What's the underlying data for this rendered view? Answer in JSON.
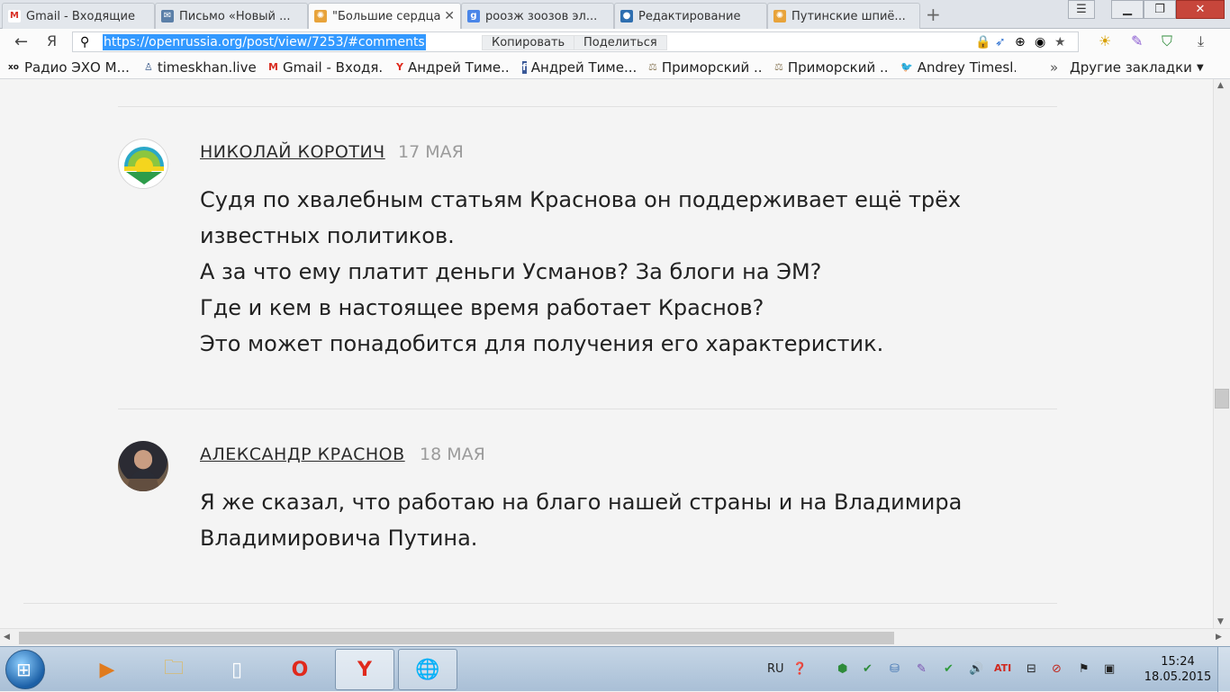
{
  "tabs": [
    {
      "label": "Gmail - Входящие",
      "icon": "gmail-icon",
      "active": false
    },
    {
      "label": "Письмо «Новый ...",
      "icon": "mail-icon",
      "active": false
    },
    {
      "label": "\"Большие сердца",
      "icon": "openrussia-icon",
      "active": true
    },
    {
      "label": "роозж зоозов эл...",
      "icon": "google-icon",
      "active": false
    },
    {
      "label": "Редактирование",
      "icon": "edit-icon",
      "active": false
    },
    {
      "label": "Путинские шпиё...",
      "icon": "openrussia-icon",
      "active": false
    }
  ],
  "toolbar": {
    "back_label": "←",
    "yandex_label": "Я",
    "url": "https://openrussia.org/post/view/7253/#comments",
    "copy_label": "Копировать",
    "share_label": "Поделиться"
  },
  "bookmarks": [
    {
      "label": "Радио ЭХО М...",
      "icon": "echo-icon"
    },
    {
      "label": "timeskhan.live...",
      "icon": "livejournal-icon"
    },
    {
      "label": "Gmail - Входя...",
      "icon": "gmail-icon"
    },
    {
      "label": "Андрей Тиме...",
      "icon": "yandex-icon"
    },
    {
      "label": "Андрей Тиме...",
      "icon": "facebook-icon"
    },
    {
      "label": "Приморский ...",
      "icon": "scales-icon"
    },
    {
      "label": "Приморский ...",
      "icon": "scales-icon"
    },
    {
      "label": "Andrey Timesl...",
      "icon": "twitter-icon"
    }
  ],
  "other_bookmarks_label": "Другие закладки",
  "comments": [
    {
      "author": "НИКОЛАЙ КОРОТИЧ",
      "date": "17 МАЯ",
      "lines": [
        "Судя по хвалебным статьям Краснова он поддерживает ещё трёх",
        "известных политиков.",
        "А за что ему платит деньги Усманов? За блоги на ЭМ?",
        "Где и кем в настоящее время работает Краснов?",
        "Это может понадобится для получения его характеристик."
      ]
    },
    {
      "author": "АЛЕКСАНДР КРАСНОВ",
      "date": "18 МАЯ",
      "lines": [
        "Я же сказал, что работаю на благо нашей страны и на Владимира",
        "Владимировича Путина."
      ]
    }
  ],
  "taskbar": {
    "lang": "RU",
    "time": "15:24",
    "date": "18.05.2015"
  }
}
